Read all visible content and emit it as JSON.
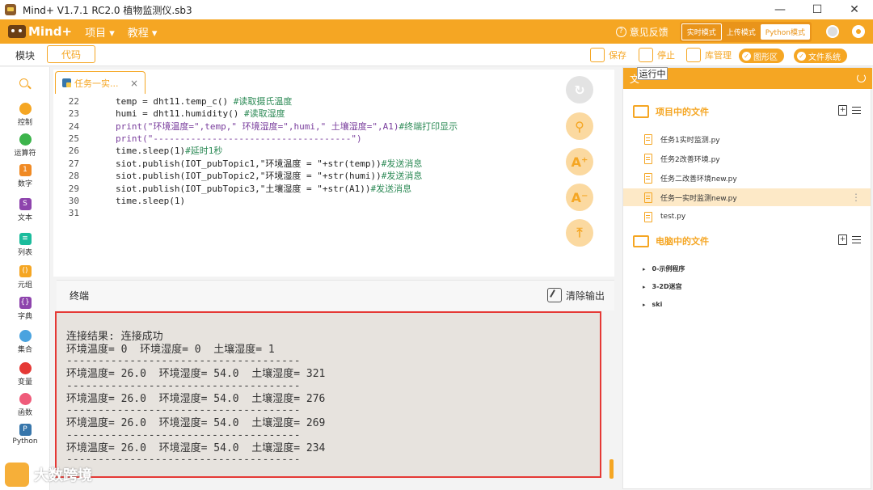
{
  "window": {
    "title": "Mind+ V1.7.1 RC2.0   植物监测仪.sb3",
    "minimize": "—",
    "maximize": "☐",
    "close": "✕"
  },
  "header": {
    "logo": "Mind+",
    "menus": [
      "项目 ▾",
      "教程 ▾"
    ],
    "feedback": "意见反馈",
    "modes": [
      "实时模式",
      "上传模式",
      "Python模式"
    ]
  },
  "toolbar": {
    "tab_blocks": "模块",
    "tab_code": "代码",
    "save": "保存",
    "stop": "停止",
    "library": "库管理",
    "graphics": "图形区",
    "filesystem": "文件系统",
    "tooltip": "运行中"
  },
  "palette": [
    {
      "label": "控制",
      "color": "#f5a623"
    },
    {
      "label": "运算符",
      "color": "#3cb44b"
    },
    {
      "label": "数字",
      "color": "#f08a24"
    },
    {
      "label": "文本",
      "color": "#8e44ad"
    },
    {
      "label": "列表",
      "color": "#1abc9c"
    },
    {
      "label": "元组",
      "color": "#f5a623"
    },
    {
      "label": "字典",
      "color": "#8e44ad"
    },
    {
      "label": "集合",
      "color": "#4aa3df"
    },
    {
      "label": "变量",
      "color": "#e53935"
    },
    {
      "label": "函数",
      "color": "#ef5b7a"
    },
    {
      "label": "Python",
      "color": "#3776ab"
    }
  ],
  "editor": {
    "tab_label": "任务一实...",
    "tab_close": "×",
    "lines": [
      {
        "n": "22",
        "code": "temp = dht11.temp_c() ",
        "comment": "#读取摄氏温度"
      },
      {
        "n": "23",
        "code": "humi = dht11.humidity() ",
        "comment": "#读取湿度"
      },
      {
        "n": "24",
        "code": "print(\"环境温度=\",temp,\" 环境湿度=\",humi,\" 土壤湿度=\",A1)",
        "comment": "#终端打印显示"
      },
      {
        "n": "25",
        "code": "print(\"-------------------------------------\")",
        "comment": ""
      },
      {
        "n": "26",
        "code": "time.sleep(1)",
        "comment": "#延时1秒"
      },
      {
        "n": "27",
        "code": "siot.publish(IOT_pubTopic1,\"环境温度 = \"+str(temp))",
        "comment": "#发送消息"
      },
      {
        "n": "28",
        "code": "siot.publish(IOT_pubTopic2,\"环境湿度 = \"+str(humi))",
        "comment": "#发送消息"
      },
      {
        "n": "29",
        "code": "siot.publish(IOT_pubTopic3,\"土壤湿度 = \"+str(A1))",
        "comment": "#发送消息"
      },
      {
        "n": "30",
        "code": "time.sleep(1)",
        "comment": ""
      },
      {
        "n": "31",
        "code": "",
        "comment": ""
      }
    ]
  },
  "terminal": {
    "title": "终端",
    "clear": "清除输出",
    "output": [
      "连接结果: 连接成功",
      "环境温度= 0  环境湿度= 0  土壤湿度= 1",
      "-------------------------------------",
      "环境温度= 26.0  环境湿度= 54.0  土壤湿度= 321",
      "-------------------------------------",
      "环境温度= 26.0  环境湿度= 54.0  土壤湿度= 276",
      "-------------------------------------",
      "环境温度= 26.0  环境湿度= 54.0  土壤湿度= 269",
      "-------------------------------------",
      "环境温度= 26.0  环境湿度= 54.0  土壤湿度= 234",
      "-------------------------------------"
    ]
  },
  "files": {
    "header": "文",
    "project_title": "项目中的文件",
    "project_files": [
      "任务1实时监测.py",
      "任务2改善环境.py",
      "任务二改善环境new.py",
      "任务一实时监测new.py",
      "test.py"
    ],
    "active_index": 3,
    "computer_title": "电脑中的文件",
    "computer_items": [
      "0-示例程序",
      "3-2D迷宫",
      "ski"
    ]
  },
  "watermark": "大数跨境"
}
